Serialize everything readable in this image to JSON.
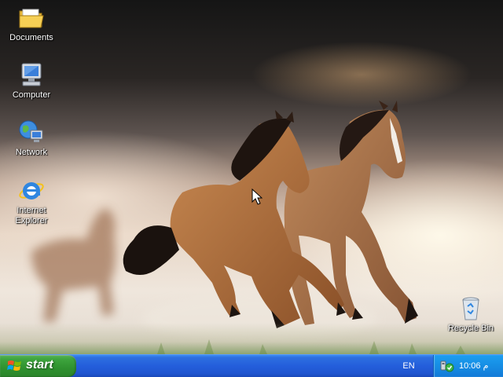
{
  "desktop": {
    "icons": [
      {
        "label": "Documents",
        "icon": "folder-icon"
      },
      {
        "label": "Computer",
        "icon": "computer-icon"
      },
      {
        "label": "Network",
        "icon": "network-icon"
      },
      {
        "label": "Internet Explorer",
        "icon": "internet-explorer-icon"
      },
      {
        "label": "Recycle Bin",
        "icon": "recycle-bin-icon"
      }
    ],
    "wallpaper": "horses-icon",
    "cursor": "mouse-pointer-icon"
  },
  "taskbar": {
    "start_label": "start",
    "start_icon": "windows-logo-icon",
    "language": "EN",
    "tray_icon": "safely-remove-hardware-icon",
    "clock": "10:06 م"
  },
  "colors": {
    "taskbar": "#245edb",
    "start_button": "#3da43d",
    "tray": "#1791e6"
  }
}
